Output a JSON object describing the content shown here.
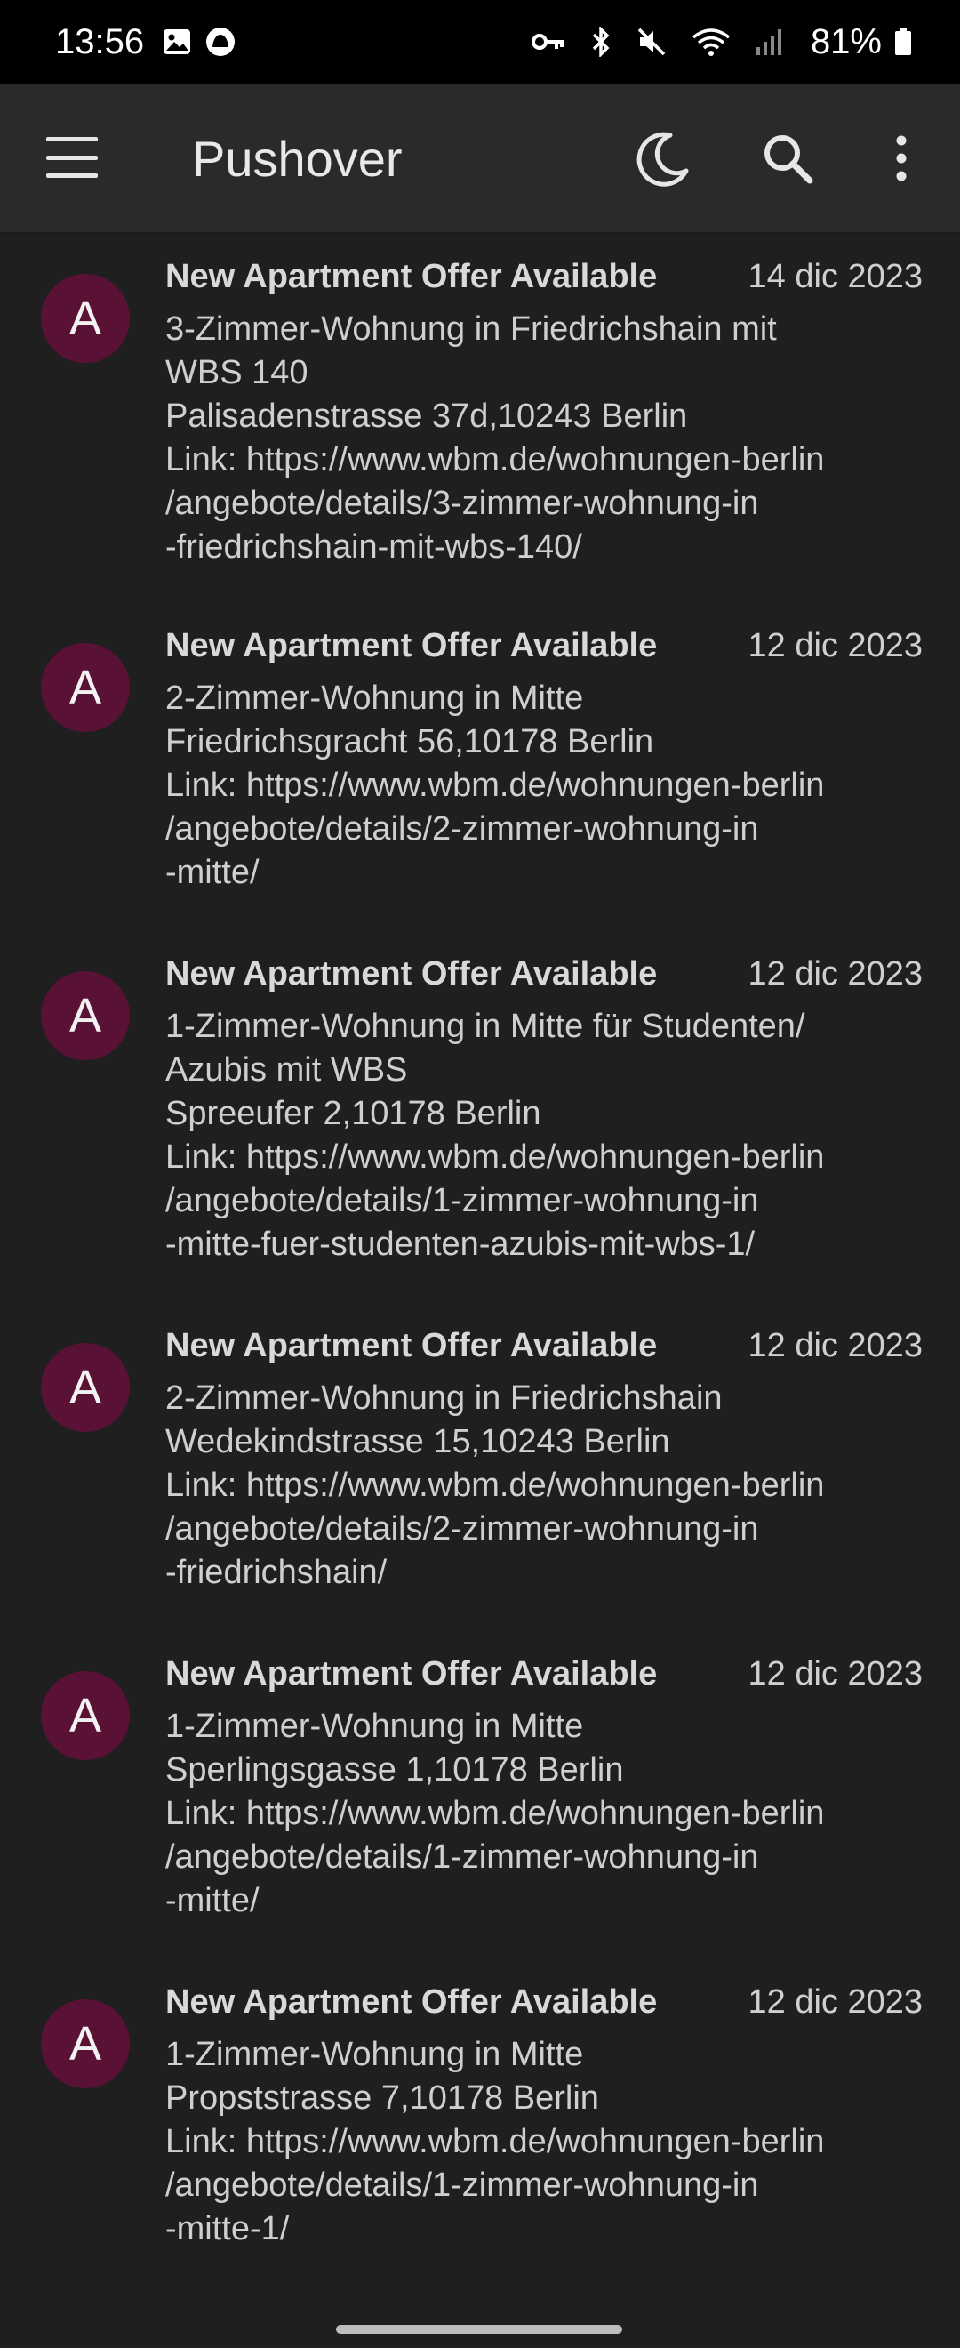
{
  "status_bar": {
    "time": "13:56",
    "battery": "81%"
  },
  "app_bar": {
    "title": "Pushover"
  },
  "messages": [
    {
      "avatar": "A",
      "title": "New Apartment Offer Available",
      "date": "14 dic 2023",
      "lines": [
        "3-Zimmer-Wohnung in Friedrichshain mit",
        "WBS 140",
        "Palisadenstrasse 37d,10243 Berlin",
        "Link: https://www.wbm.de/wohnungen-berlin",
        "/angebote/details/3-zimmer-wohnung-in",
        "-friedrichshain-mit-wbs-140/"
      ]
    },
    {
      "avatar": "A",
      "title": "New Apartment Offer Available",
      "date": "12 dic 2023",
      "lines": [
        "2-Zimmer-Wohnung in Mitte",
        "Friedrichsgracht 56,10178 Berlin",
        "Link: https://www.wbm.de/wohnungen-berlin",
        "/angebote/details/2-zimmer-wohnung-in",
        "-mitte/"
      ]
    },
    {
      "avatar": "A",
      "title": "New Apartment Offer Available",
      "date": "12 dic 2023",
      "lines": [
        "1-Zimmer-Wohnung in Mitte für Studenten/",
        "Azubis mit WBS",
        "Spreeufer 2,10178 Berlin",
        "Link: https://www.wbm.de/wohnungen-berlin",
        "/angebote/details/1-zimmer-wohnung-in",
        "-mitte-fuer-studenten-azubis-mit-wbs-1/"
      ]
    },
    {
      "avatar": "A",
      "title": "New Apartment Offer Available",
      "date": "12 dic 2023",
      "lines": [
        "2-Zimmer-Wohnung in Friedrichshain",
        "Wedekindstrasse 15,10243 Berlin",
        "Link: https://www.wbm.de/wohnungen-berlin",
        "/angebote/details/2-zimmer-wohnung-in",
        "-friedrichshain/"
      ]
    },
    {
      "avatar": "A",
      "title": "New Apartment Offer Available",
      "date": "12 dic 2023",
      "lines": [
        "1-Zimmer-Wohnung in Mitte",
        "Sperlingsgasse 1,10178 Berlin",
        "Link: https://www.wbm.de/wohnungen-berlin",
        "/angebote/details/1-zimmer-wohnung-in",
        "-mitte/"
      ]
    },
    {
      "avatar": "A",
      "title": "New Apartment Offer Available",
      "date": "12 dic 2023",
      "lines": [
        "1-Zimmer-Wohnung in Mitte",
        "Propststrasse 7,10178 Berlin",
        "Link: https://www.wbm.de/wohnungen-berlin",
        "/angebote/details/1-zimmer-wohnung-in",
        "-mitte-1/"
      ]
    }
  ],
  "colors": {
    "background": "#1f1f1f",
    "app_bar": "#2a2a2a",
    "avatar": "#5a1136"
  },
  "icons": {
    "status_left": [
      "image-icon",
      "app-notification-icon"
    ],
    "status_right": [
      "vpn-key-icon",
      "bluetooth-icon",
      "mute-icon",
      "wifi-icon",
      "signal-icon",
      "battery-icon"
    ],
    "app_bar": [
      "menu-icon",
      "moon-icon",
      "search-icon",
      "more-vert-icon"
    ]
  }
}
